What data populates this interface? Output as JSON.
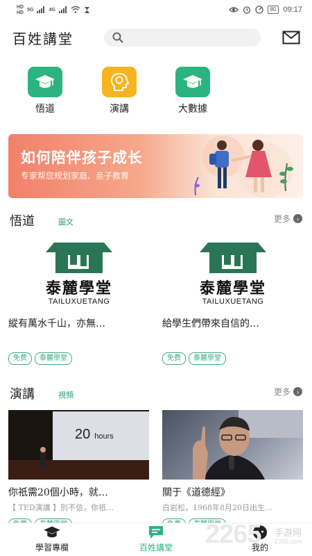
{
  "status_bar": {
    "left_labels": [
      "HD",
      "HD",
      "5G",
      "4G"
    ],
    "battery": "80",
    "time": "09:17"
  },
  "header": {
    "title": "百姓講堂",
    "search_placeholder": ""
  },
  "top_nav": [
    {
      "label": "悟道",
      "icon": "graduation-cap-icon",
      "color": "#2bb381"
    },
    {
      "label": "演講",
      "icon": "lightbulb-head-icon",
      "color": "#f6b520"
    },
    {
      "label": "大數據",
      "icon": "graduation-cap-icon",
      "color": "#2bb381"
    }
  ],
  "banner": {
    "title": "如何陪伴孩子成长",
    "subtitle": "专家帮您规划家庭、亲子教育"
  },
  "section_wudao": {
    "title": "悟道",
    "tag": "圖文",
    "more": "更多",
    "cards": [
      {
        "logo_name": "泰麓學堂",
        "logo_pinyin": "TAILUXUETANG",
        "title": "縱有萬水千山，亦無…",
        "tags": [
          "免费",
          "泰麓學堂"
        ]
      },
      {
        "logo_name": "泰麓學堂",
        "logo_pinyin": "TAILUXUETANG",
        "title": "給學生們帶來自信的…",
        "tags": [
          "免费",
          "泰麓學堂"
        ]
      }
    ]
  },
  "section_yanjiang": {
    "title": "演講",
    "tag": "視頻",
    "more": "更多",
    "cards": [
      {
        "slide_number": "20",
        "slide_word": "hours",
        "title": "你祇需20個小時，就…",
        "subtitle": "【 TED演講 】別不信，你祇…",
        "tags": [
          "免费",
          "泰麓學堂"
        ]
      },
      {
        "title": "關于《道德經》",
        "subtitle": "白岩松，1968年8月20日出生…",
        "tags": [
          "免费",
          "泰麓學堂"
        ]
      }
    ]
  },
  "bottom_nav": [
    {
      "label": "學習專欄",
      "active": false
    },
    {
      "label": "百姓講堂",
      "active": true
    },
    {
      "label": "我的",
      "active": false
    }
  ],
  "watermark": {
    "brand": "2265",
    "text": "手游网",
    "domain": "2265.com"
  },
  "colors": {
    "accent": "#2bb381",
    "yellow": "#f6b520",
    "tag": "#3fa883",
    "banner": "#f2806a"
  }
}
